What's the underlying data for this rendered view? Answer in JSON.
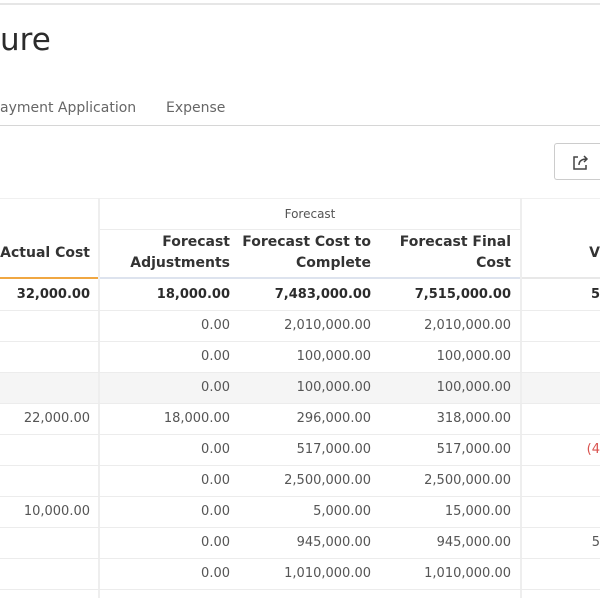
{
  "page": {
    "title": "ure"
  },
  "tabs": [
    {
      "label": "ayment Application"
    },
    {
      "label": "Expense"
    }
  ],
  "toolbar": {
    "export_icon": "share-export-icon"
  },
  "table": {
    "group_header": "Forecast",
    "columns": [
      "Actual Cost",
      "Forecast Adjustments",
      "Forecast Cost to Complete",
      "Forecast Final Cost",
      "V"
    ],
    "column_lines": [
      [
        "Actual Cost"
      ],
      [
        "Forecast",
        "Adjustments"
      ],
      [
        "Forecast Cost to",
        "Complete"
      ],
      [
        "Forecast Final",
        "Cost"
      ],
      [
        "V"
      ]
    ],
    "rows": [
      [
        "32,000.00",
        "18,000.00",
        "7,483,000.00",
        "7,515,000.00",
        "5"
      ],
      [
        "",
        "0.00",
        "2,010,000.00",
        "2,010,000.00",
        ""
      ],
      [
        "",
        "0.00",
        "100,000.00",
        "100,000.00",
        ""
      ],
      [
        "",
        "0.00",
        "100,000.00",
        "100,000.00",
        ""
      ],
      [
        "22,000.00",
        "18,000.00",
        "296,000.00",
        "318,000.00",
        ""
      ],
      [
        "",
        "0.00",
        "517,000.00",
        "517,000.00",
        "(4"
      ],
      [
        "",
        "0.00",
        "2,500,000.00",
        "2,500,000.00",
        ""
      ],
      [
        "10,000.00",
        "0.00",
        "5,000.00",
        "15,000.00",
        ""
      ],
      [
        "",
        "0.00",
        "945,000.00",
        "945,000.00",
        "5"
      ],
      [
        "",
        "0.00",
        "1,010,000.00",
        "1,010,000.00",
        ""
      ]
    ],
    "highlighted_row": 3,
    "negative_color": "#d9534f",
    "accent_underline": "#f0a742"
  }
}
